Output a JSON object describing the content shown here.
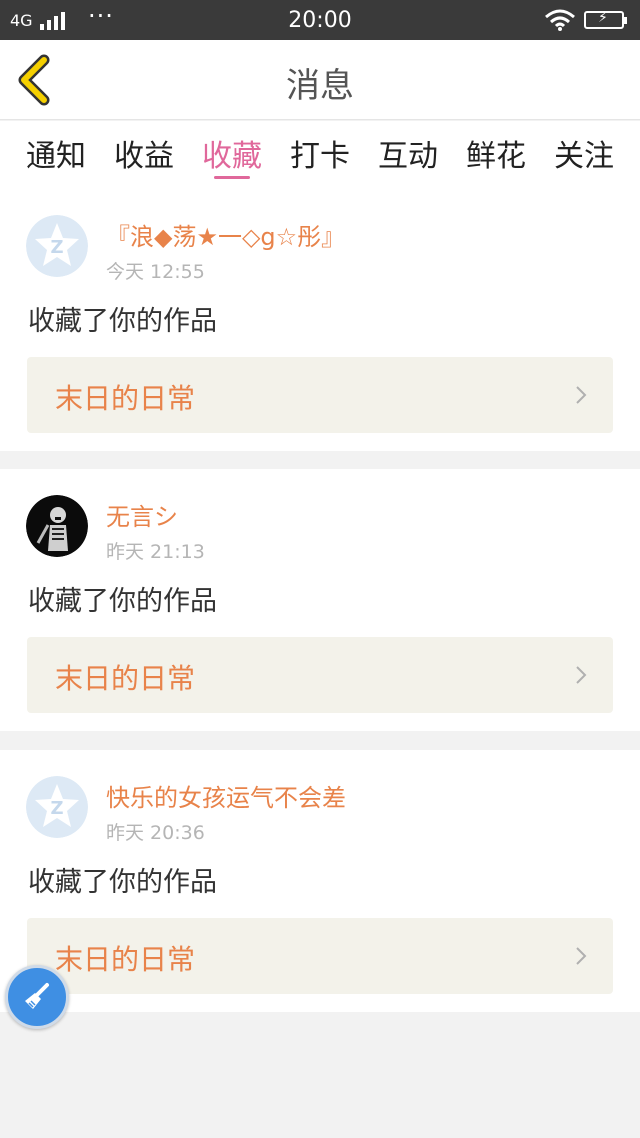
{
  "status_bar": {
    "network": "4G",
    "time": "20:00",
    "icons": [
      "signal-icon",
      "more-dots-icon",
      "wifi-icon",
      "battery-charging-icon"
    ]
  },
  "header": {
    "title": "消息",
    "back_icon": "chevron-left-icon",
    "accent_color": "#f5d000"
  },
  "tabs": [
    {
      "label": "通知",
      "active": false
    },
    {
      "label": "收益",
      "active": false
    },
    {
      "label": "收藏",
      "active": true
    },
    {
      "label": "打卡",
      "active": false
    },
    {
      "label": "互动",
      "active": false
    },
    {
      "label": "鲜花",
      "active": false
    },
    {
      "label": "关注",
      "active": false
    }
  ],
  "active_tab_color": "#e0689b",
  "messages": [
    {
      "username": "『浪◆荡★一◇g☆彤』",
      "time": "今天 12:55",
      "action": "收藏了你的作品",
      "work_title": "末日的日常",
      "avatar": "default-avatar-icon"
    },
    {
      "username": "无言シ",
      "time": "昨天 21:13",
      "action": "收藏了你的作品",
      "work_title": "末日的日常",
      "avatar": "skeleton-avatar"
    },
    {
      "username": "快乐的女孩运气不会差",
      "time": "昨天 20:36",
      "action": "收藏了你的作品",
      "work_title": "末日的日常",
      "avatar": "default-avatar-icon"
    }
  ],
  "name_color": "#e8834a",
  "floating_button": {
    "icon": "broom-icon",
    "color": "#3f8fe3"
  }
}
